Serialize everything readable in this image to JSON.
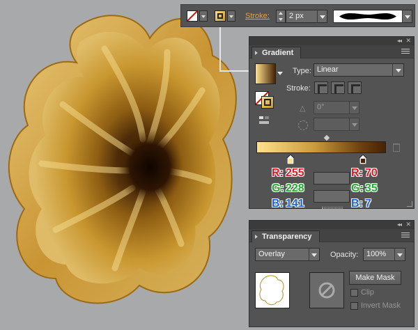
{
  "toolbar": {
    "stroke_label": "Stroke:",
    "stroke_weight": "2 px"
  },
  "gradient_panel": {
    "tab_label": "Gradient",
    "type_label": "Type:",
    "type_value": "Linear",
    "stroke_label": "Stroke:",
    "angle_value": "0°",
    "gradient_start_color": "#ffe28c",
    "gradient_end_color": "#462307",
    "left_stop": {
      "r_label": "R:",
      "r": "255",
      "g_label": "G:",
      "g": "228",
      "b_label": "B:",
      "b": "141"
    },
    "right_stop": {
      "r_label": "R:",
      "r": "70",
      "g_label": "G:",
      "g": "35",
      "b_label": "B:",
      "b": "7"
    }
  },
  "transparency_panel": {
    "tab_label": "Transparency",
    "blend_mode": "Overlay",
    "opacity_label": "Opacity:",
    "opacity_value": "100%",
    "make_mask_label": "Make Mask",
    "clip_label": "Clip",
    "invert_mask_label": "Invert Mask"
  },
  "colors": {
    "accent_link": "#e8a040",
    "panel_bg": "#535353",
    "canvas_bg": "#a8a9ab"
  },
  "icons": [
    "none-stroke-swatch-icon",
    "fill-stroke-swatch-icon",
    "stroke-profile-icon",
    "panel-menu-icon",
    "collapse-icon",
    "close-icon",
    "reverse-gradient-icon",
    "delete-stop-icon",
    "angle-icon",
    "aspect-ratio-icon",
    "no-mask-icon"
  ]
}
